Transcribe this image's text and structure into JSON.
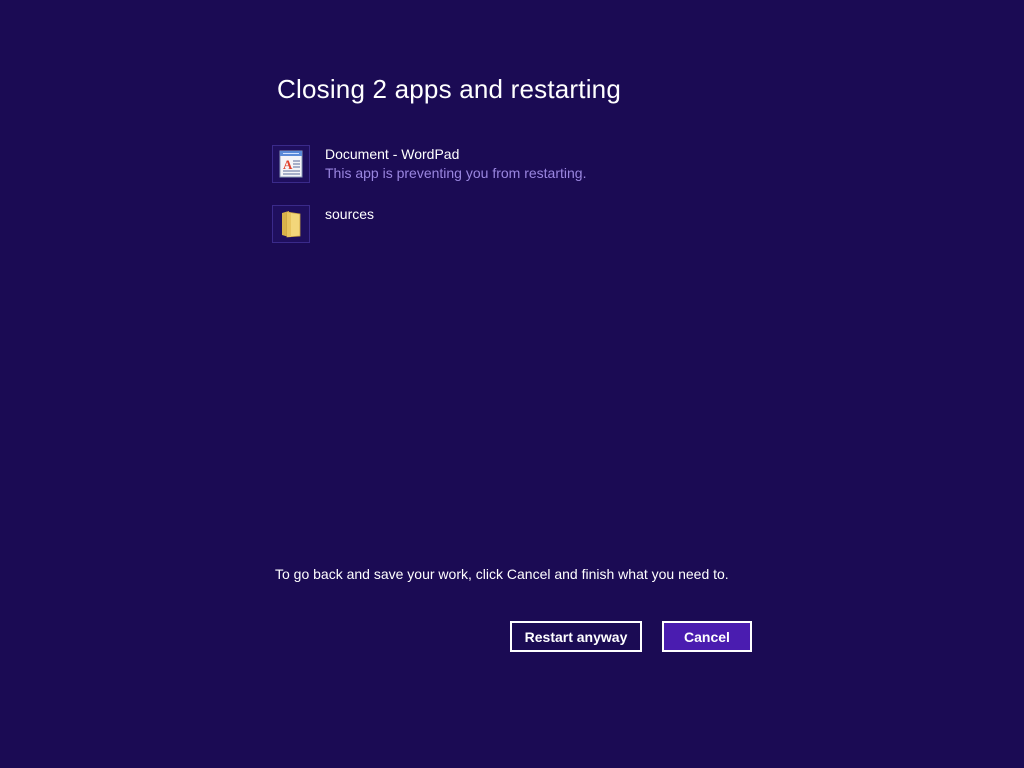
{
  "dialog": {
    "title": "Closing 2 apps and restarting",
    "hint": "To go back and save your work, click Cancel and finish what you need to."
  },
  "apps": [
    {
      "name": "Document - WordPad",
      "status": "This app is preventing you from restarting.",
      "icon": "wordpad-icon"
    },
    {
      "name": "sources",
      "status": "",
      "icon": "folder-icon"
    }
  ],
  "buttons": {
    "restart_label": "Restart anyway",
    "cancel_label": "Cancel"
  },
  "colors": {
    "background": "#1b0b54",
    "accent": "#4a1cb0",
    "status_text": "#9a86e0"
  }
}
